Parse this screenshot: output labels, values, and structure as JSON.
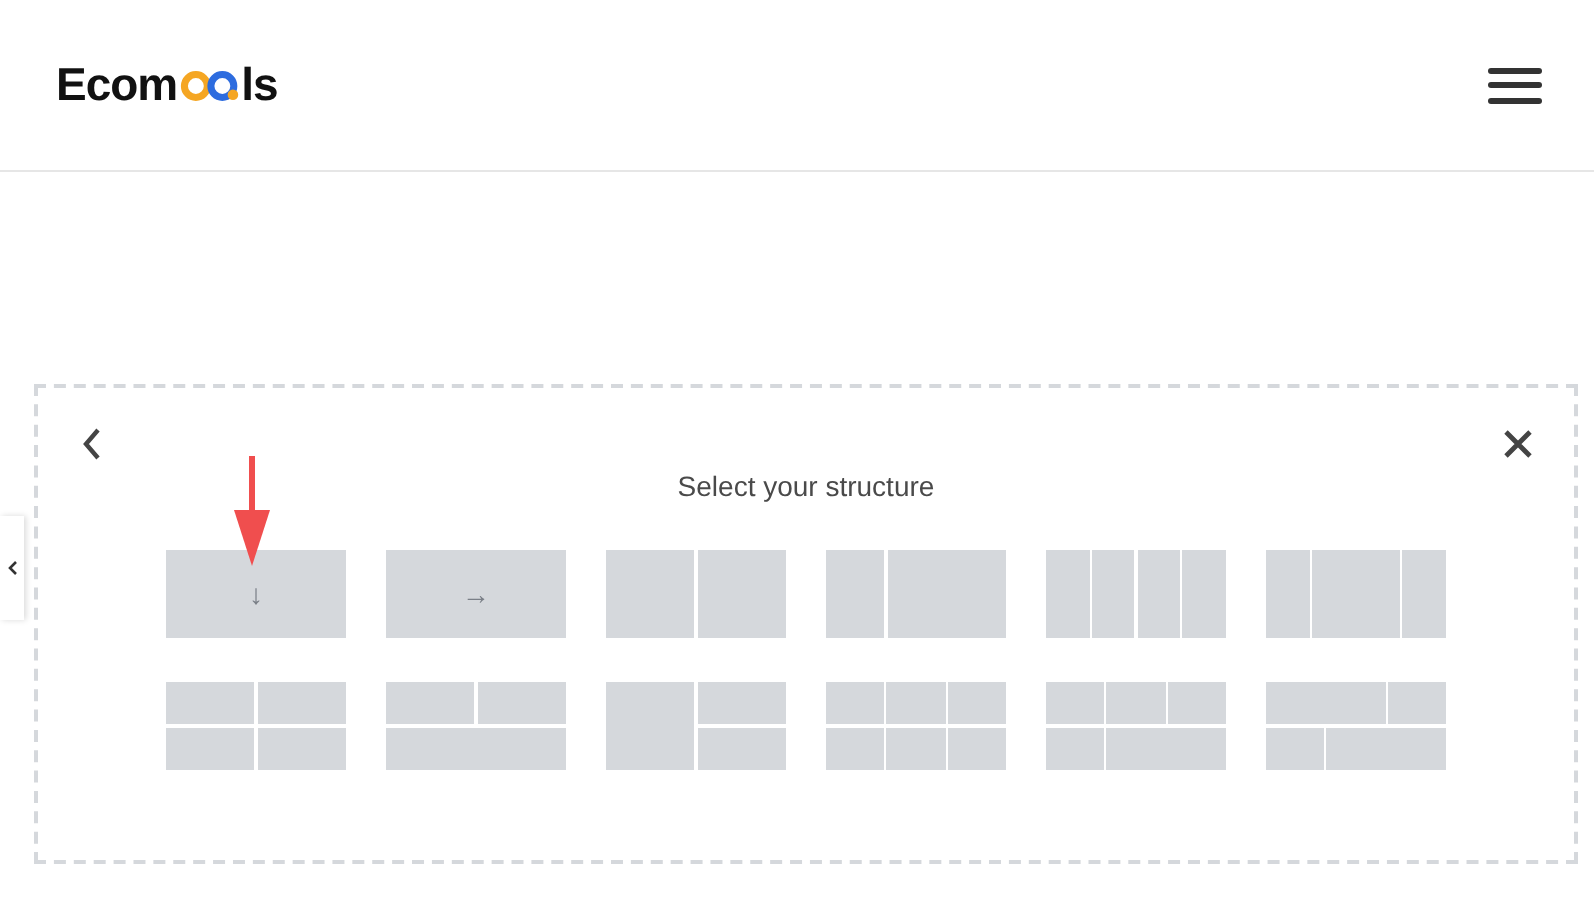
{
  "header": {
    "logo": {
      "start": "Ecom",
      "end": "ls"
    }
  },
  "panel": {
    "title": "Select your structure",
    "structures": [
      {
        "kind": "single",
        "glyph": "↓"
      },
      {
        "kind": "single",
        "glyph": "→"
      },
      {
        "kind": "halves"
      },
      {
        "kind": "third-twothirds"
      },
      {
        "kind": "quarters"
      },
      {
        "kind": "quarter-half-quarter"
      },
      {
        "kind": "grid-2x2"
      },
      {
        "kind": "two-over-one"
      },
      {
        "kind": "one-beside-two"
      },
      {
        "kind": "grid-3x2"
      },
      {
        "kind": "three-over-two"
      },
      {
        "kind": "two-over-two"
      }
    ]
  }
}
